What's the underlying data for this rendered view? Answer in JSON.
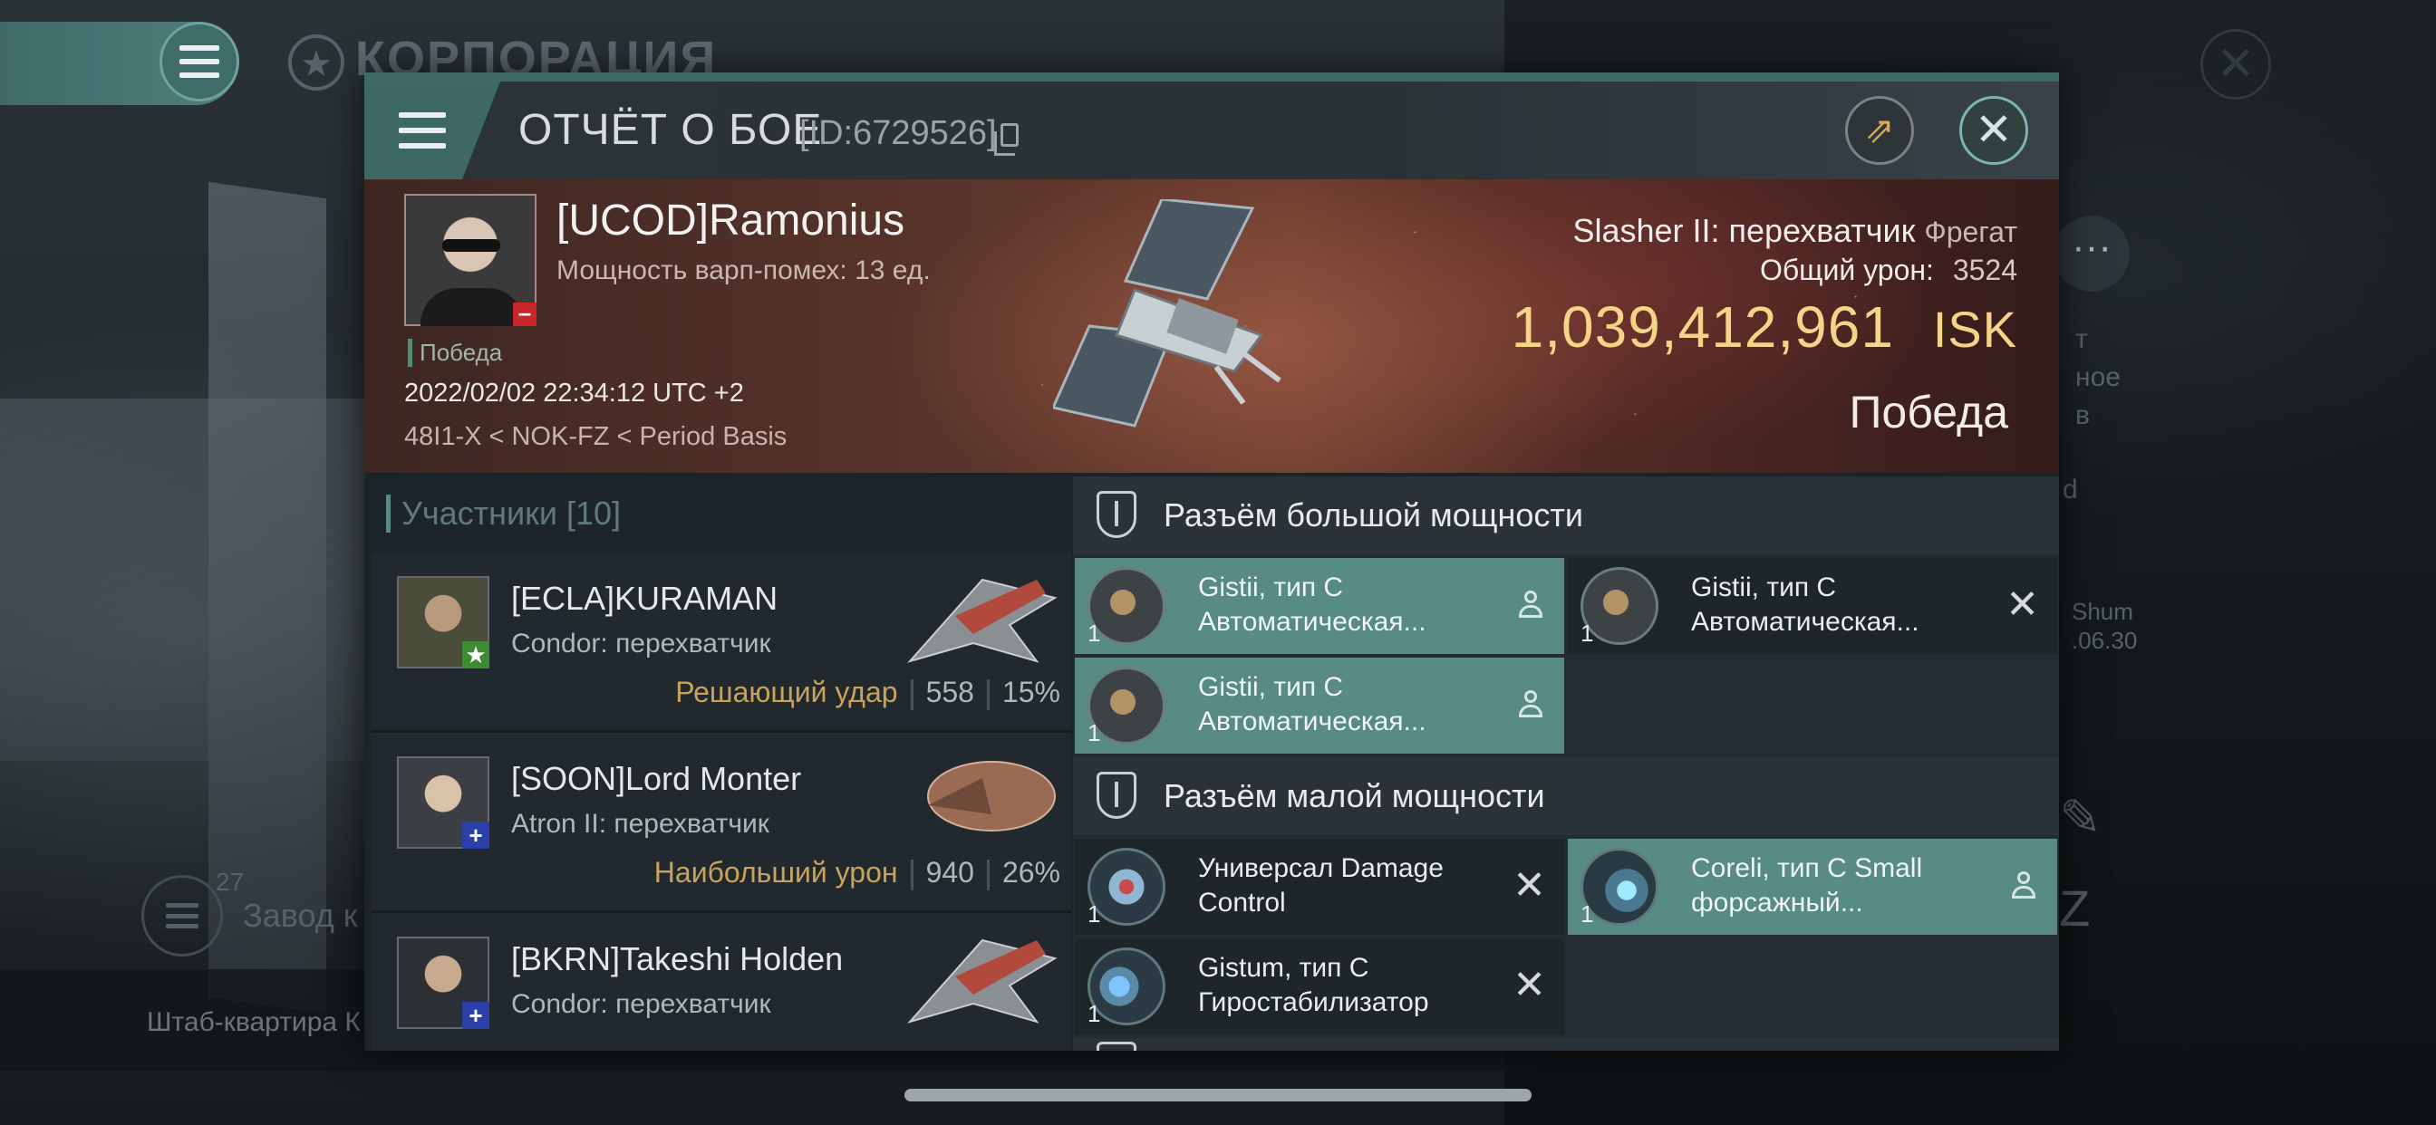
{
  "background": {
    "corp_title": "КОРПОРАЦИЯ",
    "side_text_1": "т",
    "side_text_2": "ное",
    "side_text_3": "в",
    "side_text_4": "d",
    "side_text_5": "Shum",
    "side_text_6": ".06.30",
    "bottom_count": "27",
    "bottom_label": "Завод к",
    "bottom_hq": "Штаб-квартира К"
  },
  "header": {
    "title": "ОТЧЁТ О БОЕ",
    "id_text": "[ID:6729526]"
  },
  "victim": {
    "name": "[UCOD]Ramonius",
    "warp_disruption": "Мощность варп-помех: 13 ед.",
    "tag": "Победа",
    "datetime": "2022/02/02 22:34:12 UTC +2",
    "location": "48I1-X < NOK-FZ < Period Basis",
    "ship_name": "Slasher II: перехватчик",
    "ship_class": "Фрегат",
    "damage_label": "Общий урон:",
    "damage_value": "3524",
    "isk_value": "1,039,412,961",
    "isk_currency": "ISK",
    "result": "Победа"
  },
  "participants": {
    "heading": "Участники",
    "count": "[10]",
    "items": [
      {
        "name": "[ECLA]KURAMAN",
        "ship": "Condor: перехватчик",
        "role": "Решающий удар",
        "damage": "558",
        "percent": "15%"
      },
      {
        "name": "[SOON]Lord Monter",
        "ship": "Atron II: перехватчик",
        "role": "Наибольший урон",
        "damage": "940",
        "percent": "26%"
      },
      {
        "name": "[BKRN]Takeshi Holden",
        "ship": "Condor: перехватчик"
      }
    ]
  },
  "fitting": {
    "high_slot_title": "Разъём большой мощности",
    "low_slot_title": "Разъём малой мощности",
    "high_modules": [
      {
        "line1": "Gistii, тип C",
        "line2": "Автоматическая...",
        "qty": "1"
      },
      {
        "line1": "Gistii, тип C",
        "line2": "Автоматическая...",
        "qty": "1"
      },
      {
        "line1": "Gistii, тип C",
        "line2": "Автоматическая...",
        "qty": "1"
      }
    ],
    "low_modules": [
      {
        "line1": "Универсал Damage",
        "line2": "Control",
        "qty": "1"
      },
      {
        "line1": "Coreli, тип C Small",
        "line2": "форсажный...",
        "qty": "1"
      },
      {
        "line1": "Gistum, тип C",
        "line2": "Гиростабилизатор",
        "qty": "1"
      }
    ]
  },
  "colors": {
    "accent_teal": "#578b84",
    "isk_gold": "#f5d388",
    "role_gold": "#c9a35b",
    "loss_red": "#c8262b"
  }
}
